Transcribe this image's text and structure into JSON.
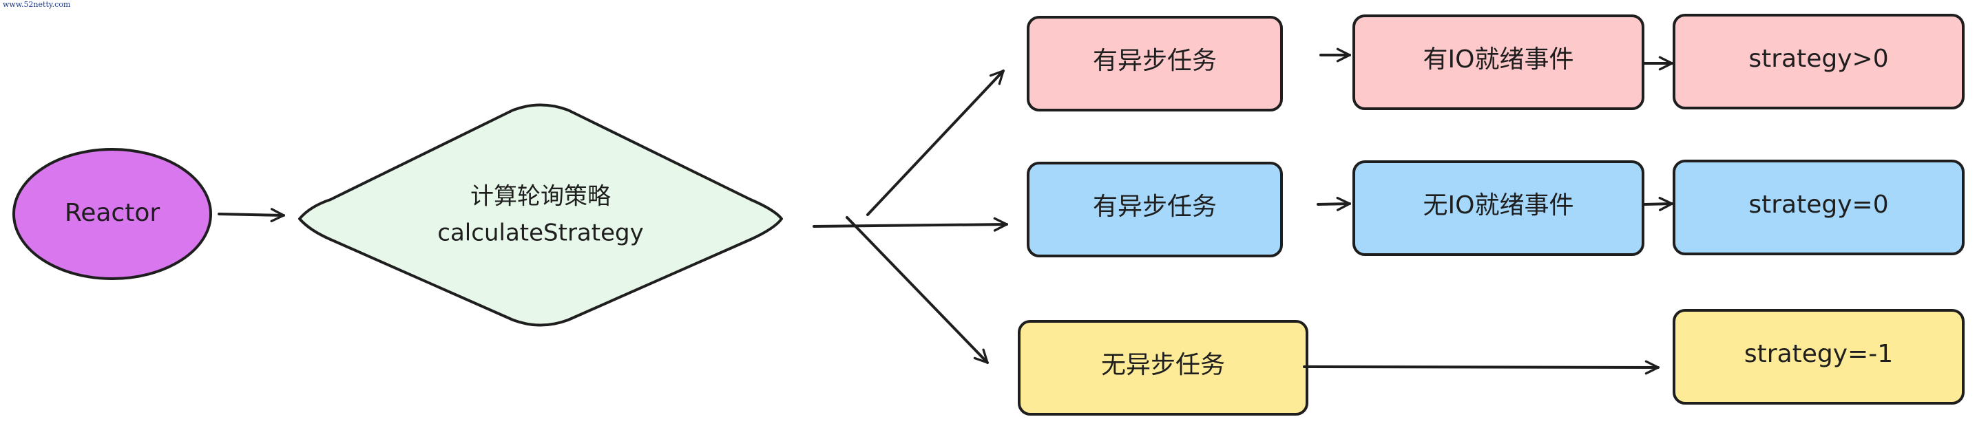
{
  "watermark": "www.52netty.com",
  "colors": {
    "reactor": "#d977ef",
    "diamond": "#e7f8ea",
    "pink": "#fdc9ca",
    "blue": "#a6d8fb",
    "yellow": "#fdeb98",
    "stroke": "#1e1e1e"
  },
  "nodes": {
    "reactor": "Reactor",
    "strategy_cn": "计算轮询策略",
    "strategy_en": "calculateStrategy",
    "row1": {
      "condition": "有异步任务",
      "io": "有IO就绪事件",
      "result": "strategy>0"
    },
    "row2": {
      "condition": "有异步任务",
      "io": "无IO就绪事件",
      "result": "strategy=0"
    },
    "row3": {
      "condition": "无异步任务",
      "result": "strategy=-1"
    }
  }
}
